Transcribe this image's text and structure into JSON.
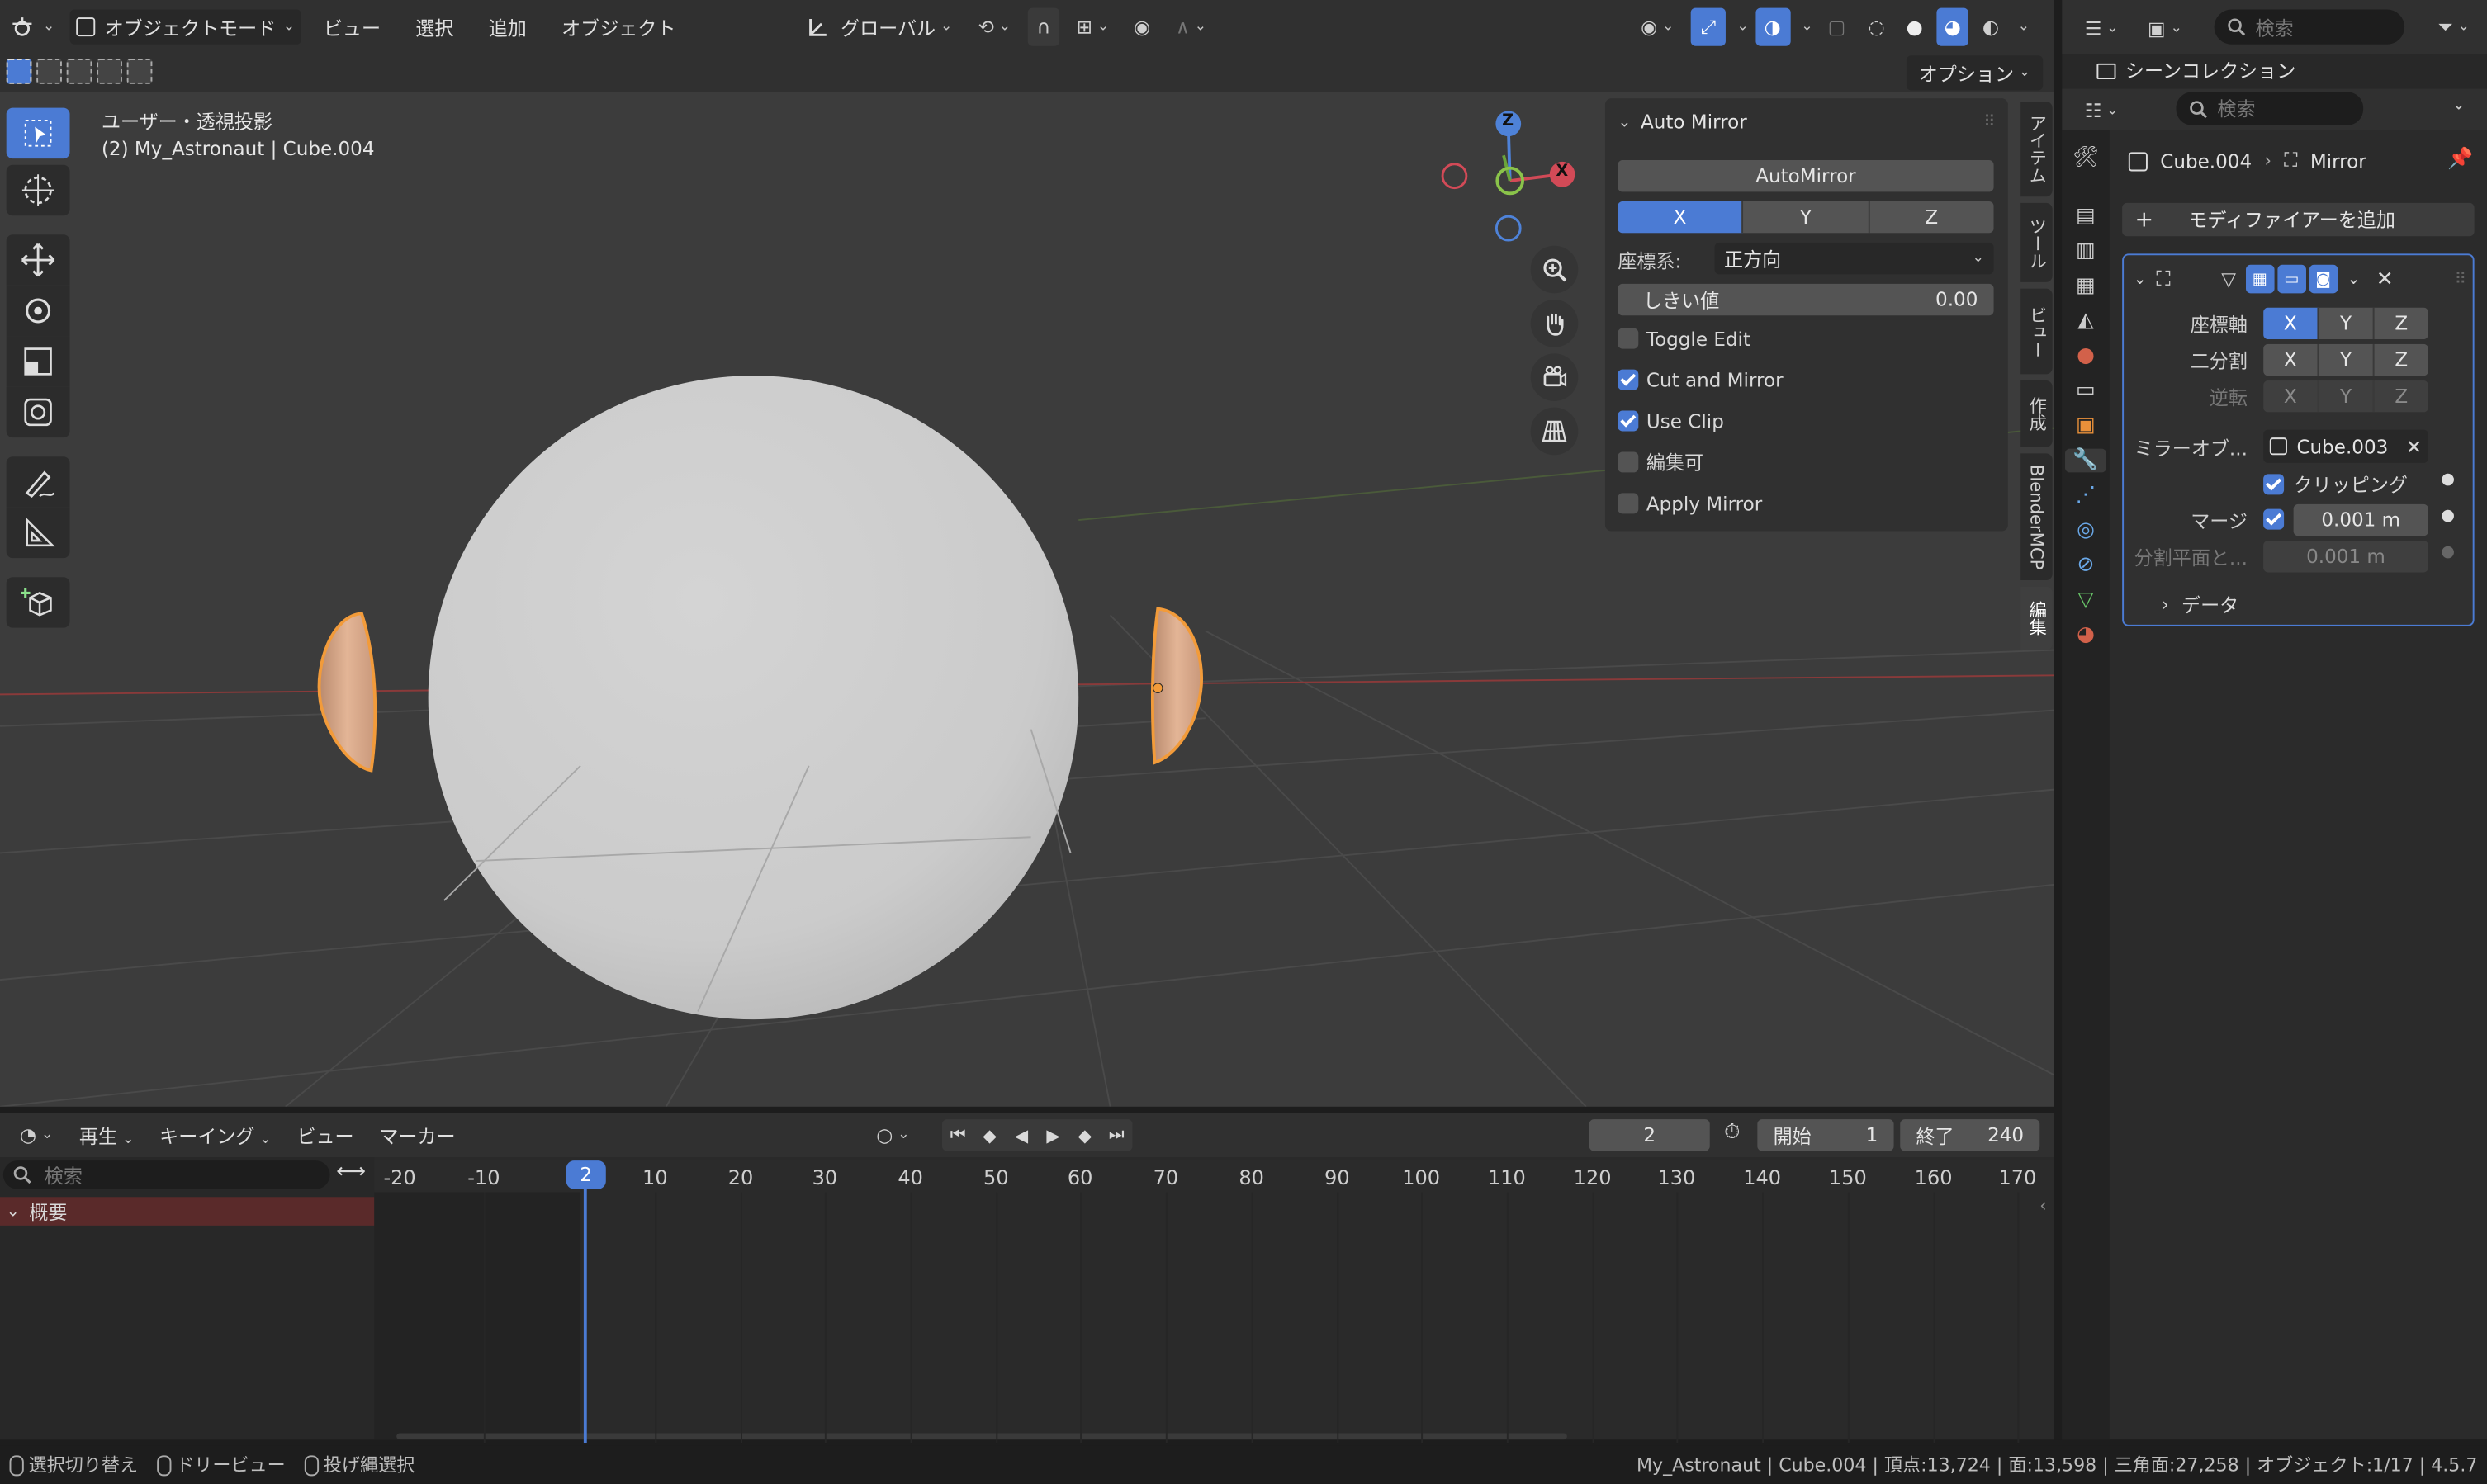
{
  "header": {
    "mode": "オブジェクトモード",
    "menus": [
      "ビュー",
      "選択",
      "追加",
      "オブジェクト"
    ],
    "transform_orientation": "グローバル",
    "options": "オプション"
  },
  "viewport": {
    "view_name": "ユーザー・透視投影",
    "object_info": "(2) My_Astronaut | Cube.004",
    "gizmo": {
      "x": "X",
      "y": "Y",
      "z": "Z"
    }
  },
  "auto_mirror": {
    "title": "Auto Mirror",
    "button": "AutoMirror",
    "axes": [
      "X",
      "Y",
      "Z"
    ],
    "axis_selected": "X",
    "orientation_label": "座標系:",
    "orientation_value": "正方向",
    "threshold_label": "しきい値",
    "threshold_value": "0.00",
    "toggles": [
      {
        "label": "Toggle Edit",
        "checked": false
      },
      {
        "label": "Cut and Mirror",
        "checked": true
      },
      {
        "label": "Use Clip",
        "checked": true
      },
      {
        "label": "編集可",
        "checked": false
      },
      {
        "label": "Apply Mirror",
        "checked": false
      }
    ]
  },
  "side_tabs": [
    "アイテム",
    "ツール",
    "ビュー",
    "作成",
    "BlenderMCP",
    "編集"
  ],
  "outliner": {
    "search_placeholder": "検索",
    "scene_collection": "シーンコレクション"
  },
  "properties": {
    "search_placeholder": "検索",
    "breadcrumb_object": "Cube.004",
    "breadcrumb_modifier": "Mirror",
    "add_modifier": "モディファイアーを追加",
    "axis_label": "座標軸",
    "bisect_label": "二分割",
    "flip_label": "逆転",
    "xyz": [
      "X",
      "Y",
      "Z"
    ],
    "mirror_object_label": "ミラーオブ...",
    "mirror_object_value": "Cube.003",
    "clipping_label": "クリッピング",
    "merge_label": "マージ",
    "merge_value": "0.001 m",
    "bisect_distance_label": "分割平面と...",
    "bisect_distance_value": "0.001 m",
    "data_label": "データ"
  },
  "timeline": {
    "menus": [
      "再生",
      "キーイング",
      "ビュー",
      "マーカー"
    ],
    "current_frame": "2",
    "start_label": "開始",
    "start": "1",
    "end_label": "終了",
    "end": "240",
    "search_placeholder": "検索",
    "summary": "概要",
    "ticks": [
      "-20",
      "-10",
      "2",
      "10",
      "20",
      "30",
      "40",
      "50",
      "60",
      "70",
      "80",
      "90",
      "100",
      "110",
      "120",
      "130",
      "140",
      "150",
      "160",
      "170"
    ]
  },
  "status_bar": {
    "left": [
      "選択切り替え",
      "ドリービュー",
      "投げ縄選択"
    ],
    "right": "My_Astronaut | Cube.004 | 頂点:13,724 | 面:13,598 | 三角面:27,258 | オブジェクト:1/17 | 4.5.7"
  }
}
